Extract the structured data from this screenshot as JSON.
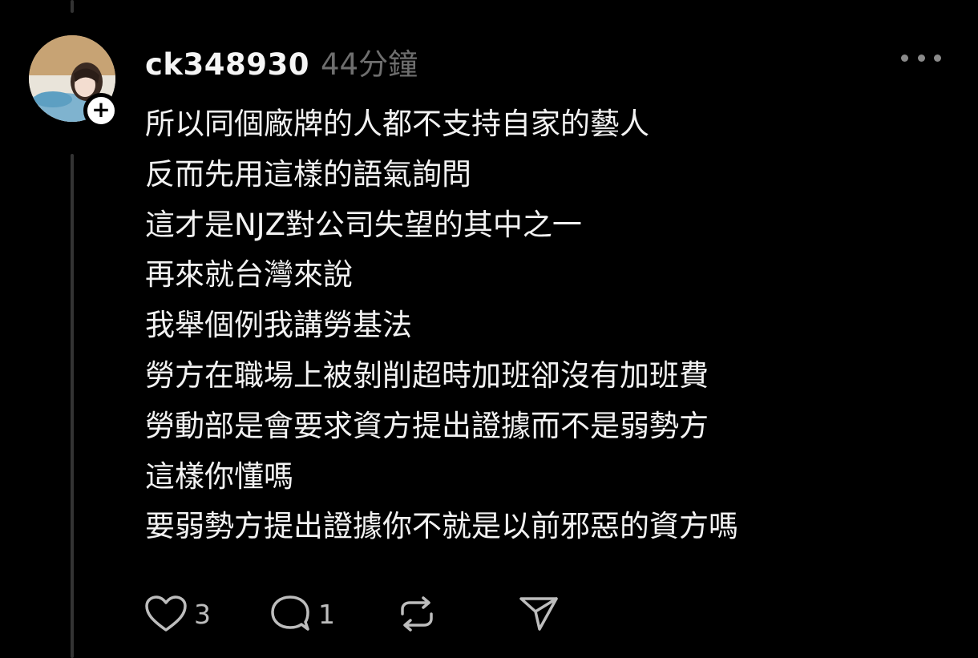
{
  "post": {
    "username": "ck348930",
    "timestamp": "44分鐘",
    "lines": [
      "所以同個廠牌的人都不支持自家的藝人",
      "反而先用這樣的語氣詢問",
      "這才是NJZ對公司失望的其中之一",
      "再來就台灣來說",
      "我舉個例我講勞基法",
      "勞方在職場上被剝削超時加班卻沒有加班費",
      "勞動部是會要求資方提出證據而不是弱勢方",
      "這樣你懂嗎",
      "要弱勢方提出證據你不就是以前邪惡的資方嗎"
    ]
  },
  "follow_badge": {
    "symbol": "+"
  },
  "actions": {
    "like_count": "3",
    "reply_count": "1"
  },
  "icons": {
    "more": "more-horizontal-icon",
    "like": "heart-icon",
    "reply": "comment-bubble-icon",
    "repost": "repost-icon",
    "share": "send-icon"
  },
  "colors": {
    "background": "#000000",
    "text": "#f2f2f2",
    "muted": "#6e6e6e",
    "icon": "#bdbdbd",
    "thread_line": "#333333"
  }
}
